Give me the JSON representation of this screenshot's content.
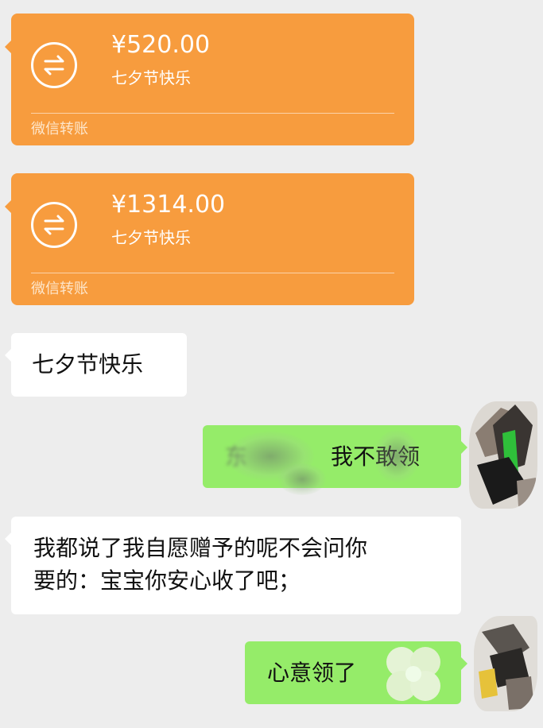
{
  "transfers": [
    {
      "amount": "¥520.00",
      "note": "七夕节快乐",
      "footer": "微信转账"
    },
    {
      "amount": "¥1314.00",
      "note": "七夕节快乐",
      "footer": "微信转账"
    }
  ],
  "messages": [
    {
      "side": "left",
      "text": "七夕节快乐"
    },
    {
      "side": "right",
      "text": "我不敢领",
      "obscured_prefix": "东"
    },
    {
      "side": "left",
      "line1": "我都说了我自愿赠予的呢不会问你",
      "line2": "要的：宝宝你安心收了吧；"
    },
    {
      "side": "right",
      "text": "心意领了"
    }
  ],
  "colors": {
    "background": "#ededed",
    "transfer": "#f79c3e",
    "bubble_left": "#ffffff",
    "bubble_right": "#95ec69"
  },
  "icons": {
    "transfer": "transfer-arrows-icon",
    "avatar": "avatar",
    "sticker": "clover-icon"
  }
}
